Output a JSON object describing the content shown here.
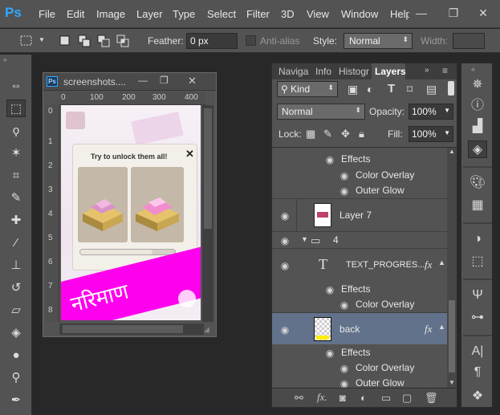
{
  "app": {
    "logo": "Ps"
  },
  "menu": [
    "File",
    "Edit",
    "Image",
    "Layer",
    "Type",
    "Select",
    "Filter",
    "3D",
    "View",
    "Window",
    "Help"
  ],
  "options": {
    "feather_label": "Feather:",
    "feather_value": "0 px",
    "antialias_label": "Anti-alias",
    "style_label": "Style:",
    "style_value": "Normal",
    "width_label": "Width:"
  },
  "document": {
    "title": "screenshots....",
    "ruler_top": [
      "0",
      "100",
      "200",
      "300",
      "400"
    ],
    "ruler_left": [
      "0",
      "1",
      "2",
      "3",
      "4",
      "5",
      "6",
      "7",
      "8"
    ],
    "popup_title": "Try to unlock them all!",
    "popup_close": "✕",
    "banner_text": "नरिमाण"
  },
  "panel": {
    "tabs": [
      "Naviga",
      "Info",
      "Histogr",
      "Layers"
    ],
    "active_tab": "Layers",
    "filter_kind": "Kind",
    "blend_mode": "Normal",
    "opacity_label": "Opacity:",
    "opacity_value": "100%",
    "lock_label": "Lock:",
    "fill_label": "Fill:",
    "fill_value": "100%",
    "layers": [
      {
        "type": "effects",
        "label": "Effects"
      },
      {
        "type": "effect",
        "label": "Color Overlay"
      },
      {
        "type": "effect",
        "label": "Outer Glow"
      },
      {
        "type": "layer",
        "label": "Layer 7"
      },
      {
        "type": "group",
        "label": "4"
      },
      {
        "type": "text",
        "label": "TEXT_PROGRES...",
        "fx": "fx"
      },
      {
        "type": "effects",
        "label": "Effects"
      },
      {
        "type": "effect",
        "label": "Color Overlay"
      },
      {
        "type": "layer",
        "label": "back",
        "fx": "fx",
        "selected": true
      },
      {
        "type": "effects",
        "label": "Effects"
      },
      {
        "type": "effect",
        "label": "Color Overlay"
      },
      {
        "type": "effect",
        "label": "Outer Glow"
      }
    ]
  },
  "colors": {
    "banner": "#ff00ee",
    "selected_row": "#62728a",
    "ps_blue": "#31a8ff"
  }
}
